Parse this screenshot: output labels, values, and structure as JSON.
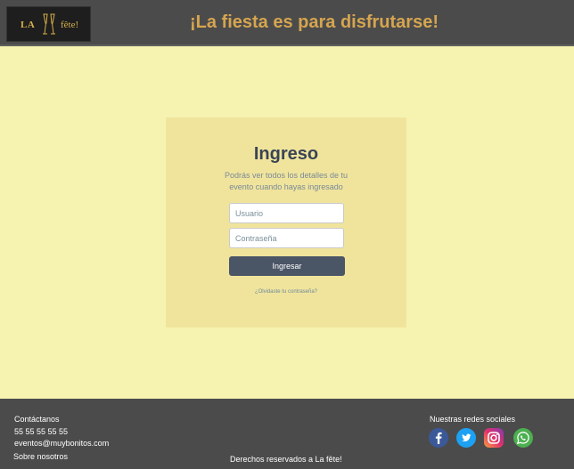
{
  "header": {
    "logo_left": "LA",
    "logo_right": "fête!",
    "tagline": "¡La fiesta es para disfrutarse!"
  },
  "login": {
    "title": "Ingreso",
    "subtitle": "Podrás ver todos los detalles de tu evento cuando hayas ingresado",
    "username_placeholder": "Usuario",
    "password_placeholder": "Contraseña",
    "submit_label": "Ingresar",
    "forgot_link": "¿Olvidaste tu contraseña?"
  },
  "footer": {
    "contact_title": "Contáctanos",
    "phone": "55 55 55 55 55",
    "email": "eventos@muybonitos.com",
    "about": "Sobre nosotros",
    "rights": "Derechos reservados a La fête!",
    "social_title": "Nuestras redes sociales",
    "social_icons": [
      "facebook-icon",
      "twitter-icon",
      "instagram-icon",
      "whatsapp-icon"
    ]
  },
  "colors": {
    "page_bg": "#f6f3b1",
    "header_bg": "#4b4b4b",
    "card_bg": "#f0e49d",
    "accent": "#d6a550",
    "button_bg": "#4a5566"
  }
}
